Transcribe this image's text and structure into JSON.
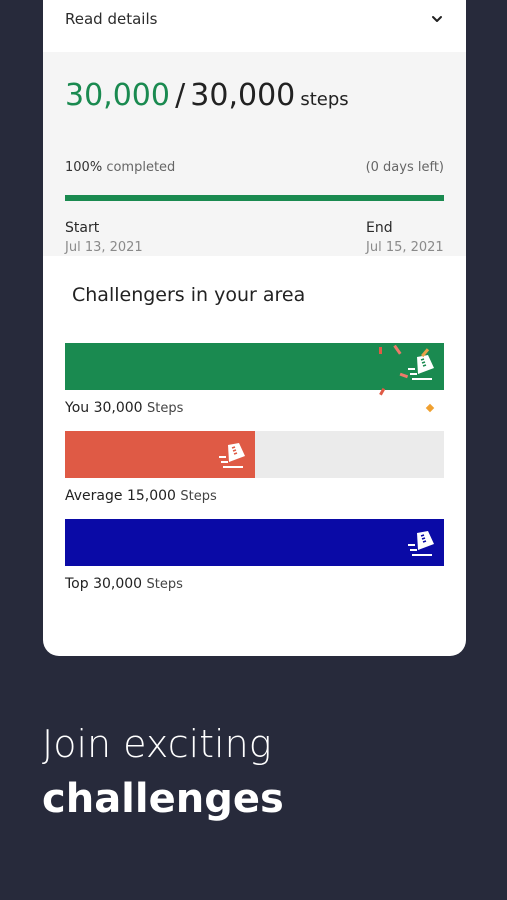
{
  "details": {
    "label": "Read details"
  },
  "progress": {
    "current": "30,000",
    "separator": "/",
    "goal": "30,000",
    "unit": "steps",
    "percent_value": "100%",
    "percent_text": "completed",
    "days_left": "(0 days left)",
    "fraction": 1.0
  },
  "dates": {
    "start_label": "Start",
    "start_value": "Jul 13, 2021",
    "end_label": "End",
    "end_value": "Jul 15, 2021"
  },
  "area": {
    "title": "Challengers in your area",
    "bars": [
      {
        "name": "You",
        "value": "30,000",
        "unit": "Steps",
        "fraction": 1.0,
        "color": "#1a8a50",
        "icon": "step-shoe-icon"
      },
      {
        "name": "Average",
        "value": "15,000",
        "unit": "Steps",
        "fraction": 0.5,
        "color": "#df5a45",
        "icon": "step-shoe-icon"
      },
      {
        "name": "Top",
        "value": "30,000",
        "unit": "Steps",
        "fraction": 1.0,
        "color": "#0a0aa6",
        "icon": "step-shoe-icon"
      }
    ]
  },
  "headline": {
    "line1": "Join exciting",
    "line2": "challenges"
  },
  "colors": {
    "background": "#272a3b",
    "accent": "#1a8a50",
    "panel": "#f5f5f5",
    "track": "#ebebeb"
  }
}
